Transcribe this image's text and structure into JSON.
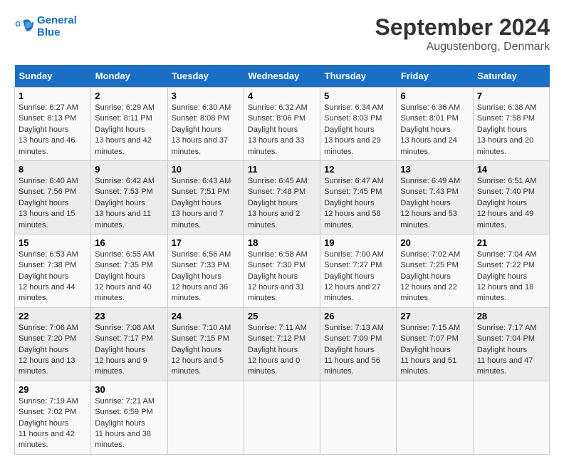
{
  "header": {
    "logo_line1": "General",
    "logo_line2": "Blue",
    "month": "September 2024",
    "location": "Augustenborg, Denmark"
  },
  "weekdays": [
    "Sunday",
    "Monday",
    "Tuesday",
    "Wednesday",
    "Thursday",
    "Friday",
    "Saturday"
  ],
  "weeks": [
    [
      {
        "day": "1",
        "sunrise": "6:27 AM",
        "sunset": "8:13 PM",
        "daylight": "13 hours and 46 minutes."
      },
      {
        "day": "2",
        "sunrise": "6:29 AM",
        "sunset": "8:11 PM",
        "daylight": "13 hours and 42 minutes."
      },
      {
        "day": "3",
        "sunrise": "6:30 AM",
        "sunset": "8:08 PM",
        "daylight": "13 hours and 37 minutes."
      },
      {
        "day": "4",
        "sunrise": "6:32 AM",
        "sunset": "8:06 PM",
        "daylight": "13 hours and 33 minutes."
      },
      {
        "day": "5",
        "sunrise": "6:34 AM",
        "sunset": "8:03 PM",
        "daylight": "13 hours and 29 minutes."
      },
      {
        "day": "6",
        "sunrise": "6:36 AM",
        "sunset": "8:01 PM",
        "daylight": "13 hours and 24 minutes."
      },
      {
        "day": "7",
        "sunrise": "6:38 AM",
        "sunset": "7:58 PM",
        "daylight": "13 hours and 20 minutes."
      }
    ],
    [
      {
        "day": "8",
        "sunrise": "6:40 AM",
        "sunset": "7:56 PM",
        "daylight": "13 hours and 15 minutes."
      },
      {
        "day": "9",
        "sunrise": "6:42 AM",
        "sunset": "7:53 PM",
        "daylight": "13 hours and 11 minutes."
      },
      {
        "day": "10",
        "sunrise": "6:43 AM",
        "sunset": "7:51 PM",
        "daylight": "13 hours and 7 minutes."
      },
      {
        "day": "11",
        "sunrise": "6:45 AM",
        "sunset": "7:48 PM",
        "daylight": "13 hours and 2 minutes."
      },
      {
        "day": "12",
        "sunrise": "6:47 AM",
        "sunset": "7:45 PM",
        "daylight": "12 hours and 58 minutes."
      },
      {
        "day": "13",
        "sunrise": "6:49 AM",
        "sunset": "7:43 PM",
        "daylight": "12 hours and 53 minutes."
      },
      {
        "day": "14",
        "sunrise": "6:51 AM",
        "sunset": "7:40 PM",
        "daylight": "12 hours and 49 minutes."
      }
    ],
    [
      {
        "day": "15",
        "sunrise": "6:53 AM",
        "sunset": "7:38 PM",
        "daylight": "12 hours and 44 minutes."
      },
      {
        "day": "16",
        "sunrise": "6:55 AM",
        "sunset": "7:35 PM",
        "daylight": "12 hours and 40 minutes."
      },
      {
        "day": "17",
        "sunrise": "6:56 AM",
        "sunset": "7:33 PM",
        "daylight": "12 hours and 36 minutes."
      },
      {
        "day": "18",
        "sunrise": "6:58 AM",
        "sunset": "7:30 PM",
        "daylight": "12 hours and 31 minutes."
      },
      {
        "day": "19",
        "sunrise": "7:00 AM",
        "sunset": "7:27 PM",
        "daylight": "12 hours and 27 minutes."
      },
      {
        "day": "20",
        "sunrise": "7:02 AM",
        "sunset": "7:25 PM",
        "daylight": "12 hours and 22 minutes."
      },
      {
        "day": "21",
        "sunrise": "7:04 AM",
        "sunset": "7:22 PM",
        "daylight": "12 hours and 18 minutes."
      }
    ],
    [
      {
        "day": "22",
        "sunrise": "7:06 AM",
        "sunset": "7:20 PM",
        "daylight": "12 hours and 13 minutes."
      },
      {
        "day": "23",
        "sunrise": "7:08 AM",
        "sunset": "7:17 PM",
        "daylight": "12 hours and 9 minutes."
      },
      {
        "day": "24",
        "sunrise": "7:10 AM",
        "sunset": "7:15 PM",
        "daylight": "12 hours and 5 minutes."
      },
      {
        "day": "25",
        "sunrise": "7:11 AM",
        "sunset": "7:12 PM",
        "daylight": "12 hours and 0 minutes."
      },
      {
        "day": "26",
        "sunrise": "7:13 AM",
        "sunset": "7:09 PM",
        "daylight": "11 hours and 56 minutes."
      },
      {
        "day": "27",
        "sunrise": "7:15 AM",
        "sunset": "7:07 PM",
        "daylight": "11 hours and 51 minutes."
      },
      {
        "day": "28",
        "sunrise": "7:17 AM",
        "sunset": "7:04 PM",
        "daylight": "11 hours and 47 minutes."
      }
    ],
    [
      {
        "day": "29",
        "sunrise": "7:19 AM",
        "sunset": "7:02 PM",
        "daylight": "11 hours and 42 minutes."
      },
      {
        "day": "30",
        "sunrise": "7:21 AM",
        "sunset": "6:59 PM",
        "daylight": "11 hours and 38 minutes."
      },
      null,
      null,
      null,
      null,
      null
    ]
  ]
}
